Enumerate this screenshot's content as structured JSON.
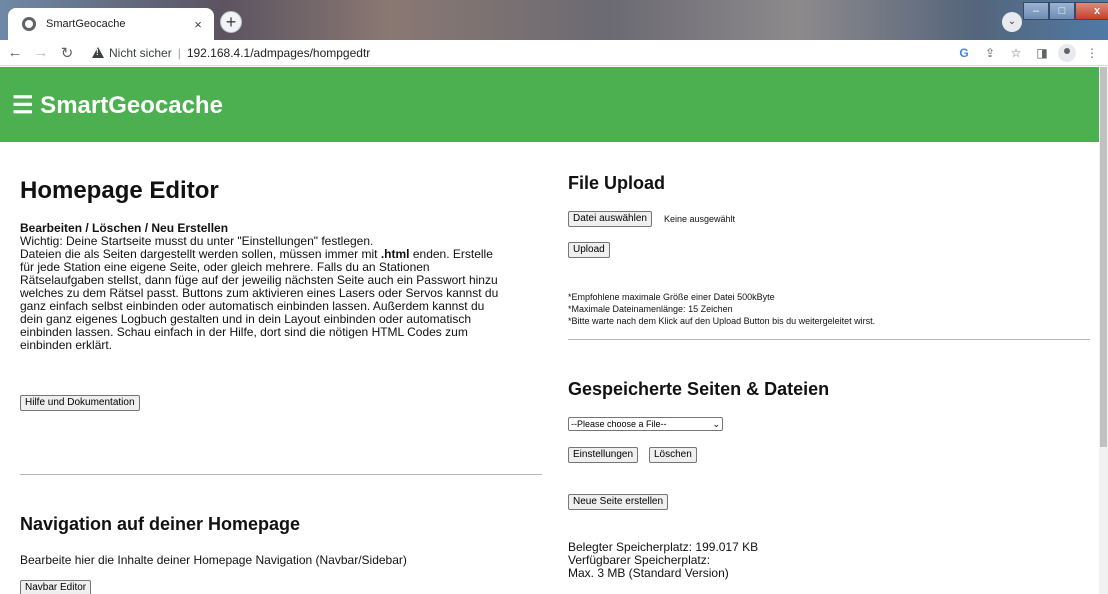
{
  "browser": {
    "tab_title": "SmartGeocache",
    "tab_close": "×",
    "new_tab": "+",
    "insecure_label": "Nicht sicher",
    "separator": "|",
    "url": "192.168.4.1/admpages/hompgedtr",
    "window_min": "–",
    "window_max": "□",
    "window_close": "x"
  },
  "header": {
    "brand": "☰ SmartGeocache",
    "color": "#4caf50"
  },
  "editor": {
    "title": "Homepage Editor",
    "subtitle": "Bearbeiten / Löschen / Neu Erstellen",
    "lines": [
      "Wichtig: Deine Startseite musst du unter \"Einstellungen\" festlegen.",
      "Dateien die als Seiten dargestellt werden sollen, müssen immer mit",
      ".html",
      " enden. Erstelle",
      "für jede Station eine eigene Seite, oder gleich mehrere. Falls du an Stationen",
      "Rätselaufgaben stellst, dann füge auf der jeweilig nächsten Seite auch ein Passwort hinzu",
      "welches zu dem Rätsel passt. Buttons zum aktivieren eines Lasers oder Servos kannst du",
      "ganz einfach selbst einbinden oder automatisch einbinden lassen. Außerdem kannst du",
      "dein ganz eigenes Logbuch gestalten und in dein Layout einbinden oder automatisch",
      "einbinden lassen. Schau einfach in der Hilfe, dort sind die nötigen HTML Codes zum",
      "einbinden erklärt."
    ],
    "help_button": "Hilfe und Dokumentation"
  },
  "navigation": {
    "title": "Navigation auf deiner Homepage",
    "text": "Bearbeite hier die Inhalte deiner Homepage Navigation (Navbar/Sidebar)",
    "navbar_button": "Navbar Editor"
  },
  "upload": {
    "title": "File Upload",
    "choose_button": "Datei auswählen",
    "no_file": "Keine ausgewählt",
    "upload_button": "Upload",
    "notes": [
      "*Empfohlene maximale Größe einer Datei 500kByte",
      "*Maximale Dateinamenlänge: 15 Zeichen",
      "*Bitte warte nach dem Klick auf den Upload Button bis du weitergeleitet wirst."
    ]
  },
  "saved": {
    "title": "Gespeicherte Seiten & Dateien",
    "select_value": "--Please choose a File--",
    "settings_button": "Einstellungen",
    "delete_button": "Löschen",
    "new_page_button": "Neue Seite erstellen",
    "used_storage": "Belegter Speicherplatz: 199.017 KB",
    "available_storage": "Verfügbarer Speicherplatz:",
    "max_storage": "Max. 3 MB (Standard Version)"
  }
}
